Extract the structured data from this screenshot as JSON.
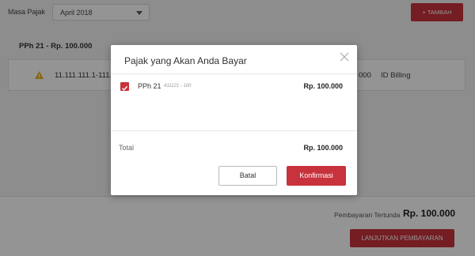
{
  "header": {
    "period_label": "Masa Pajak",
    "period_value": "April 2018",
    "add_button": "+ TAMBAH"
  },
  "section": {
    "title": "PPh 21 - Rp. 100.000"
  },
  "billing_row": {
    "number": "11.111.111.1-111.111",
    "amount_fragment": "000",
    "id_label": "ID Billing"
  },
  "footer": {
    "pending_label": "Pembayaran Tertunda",
    "pending_amount": "Rp. 100.000",
    "continue_button": "LANJUTKAN PEMBAYARAN"
  },
  "modal": {
    "title": "Pajak yang Akan Anda Bayar",
    "items": [
      {
        "name": "PPh 21",
        "code": "411121 - 100",
        "amount": "Rp. 100.000",
        "checked": true
      }
    ],
    "total_label": "Total",
    "total_amount": "Rp. 100.000",
    "cancel_button": "Batal",
    "confirm_button": "Konfirmasi"
  },
  "colors": {
    "accent": "#c8323c",
    "warning": "#e8b21e",
    "overlay": "rgba(0,0,0,0.42)"
  },
  "icons": {
    "period_dropdown": "chevron-down-icon",
    "warning": "warning-icon",
    "close": "close-icon",
    "checkbox": "checkmark-icon"
  }
}
